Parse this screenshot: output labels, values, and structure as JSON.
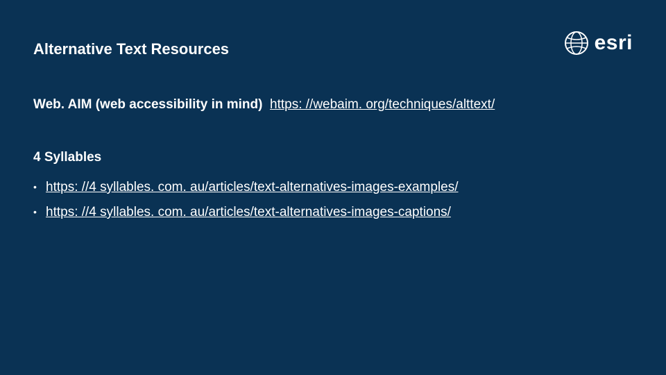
{
  "brand": "esri",
  "title": "Alternative Text Resources",
  "webaim": {
    "label": "Web. AIM (web accessibility in mind)",
    "url": "https: //webaim. org/techniques/alttext/"
  },
  "section2": {
    "heading": "4 Syllables",
    "links": [
      "https: //4 syllables. com. au/articles/text-alternatives-images-examples/",
      "https: //4 syllables. com. au/articles/text-alternatives-images-captions/"
    ]
  }
}
